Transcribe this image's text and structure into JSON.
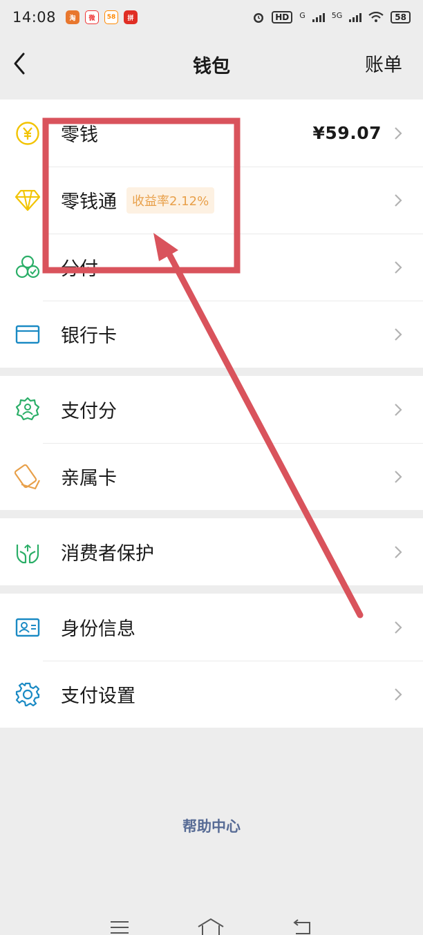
{
  "status_bar": {
    "time": "14:08",
    "apps": [
      "淘",
      "微",
      "58",
      "拼"
    ],
    "hd_label": "HD",
    "net_g": "G",
    "net_5g": "5G",
    "battery": "58"
  },
  "nav": {
    "title": "钱包",
    "right_label": "账单"
  },
  "sections": [
    [
      {
        "label": "零钱",
        "value": "¥59.07",
        "icon": "yuan-coin-icon"
      },
      {
        "label": "零钱通",
        "tag": "收益率2.12%",
        "icon": "diamond-icon"
      },
      {
        "label": "分付",
        "icon": "fenfu-icon"
      },
      {
        "label": "银行卡",
        "icon": "bank-card-icon"
      }
    ],
    [
      {
        "label": "支付分",
        "icon": "pay-score-icon"
      },
      {
        "label": "亲属卡",
        "icon": "family-card-icon"
      }
    ],
    [
      {
        "label": "消费者保护",
        "icon": "consumer-protection-icon"
      }
    ],
    [
      {
        "label": "身份信息",
        "icon": "id-card-icon"
      },
      {
        "label": "支付设置",
        "icon": "settings-gear-icon"
      }
    ]
  ],
  "help_label": "帮助中心",
  "colors": {
    "accent_green": "#2aae67",
    "accent_yellow": "#f2c300",
    "accent_blue": "#1a8ac4",
    "link_blue": "#576b95",
    "annotation_red": "#d9535c",
    "tag_text": "#e8a04a"
  }
}
